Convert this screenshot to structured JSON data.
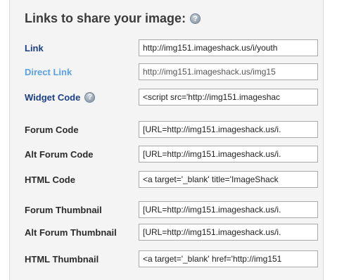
{
  "header": {
    "title": "Links to share your image:",
    "help_icon": "?"
  },
  "rows": [
    {
      "label": "Link",
      "value": "http://img151.imageshack.us/i/youth"
    },
    {
      "label": "Direct Link",
      "value": "http://img151.imageshack.us/img15"
    },
    {
      "label": "Widget Code",
      "help_icon": "?",
      "value": "<script src='http://img151.imageshac"
    },
    {
      "label": "Forum Code",
      "value": "[URL=http://img151.imageshack.us/i."
    },
    {
      "label": "Alt Forum Code",
      "value": "[URL=http://img151.imageshack.us/i."
    },
    {
      "label": "HTML Code",
      "value": "<a target='_blank' title='ImageShack"
    },
    {
      "label": "Forum Thumbnail",
      "value": "[URL=http://img151.imageshack.us/i."
    },
    {
      "label": "Alt Forum Thumbnail",
      "value": "[URL=http://img151.imageshack.us/i."
    },
    {
      "label": "HTML Thumbnail",
      "value": "<a target='_blank' href='http://img151"
    }
  ],
  "colors": {
    "link_label": "#1b3f86",
    "direct_link_label": "#5aa0e6",
    "heading": "#3b3b3b"
  }
}
